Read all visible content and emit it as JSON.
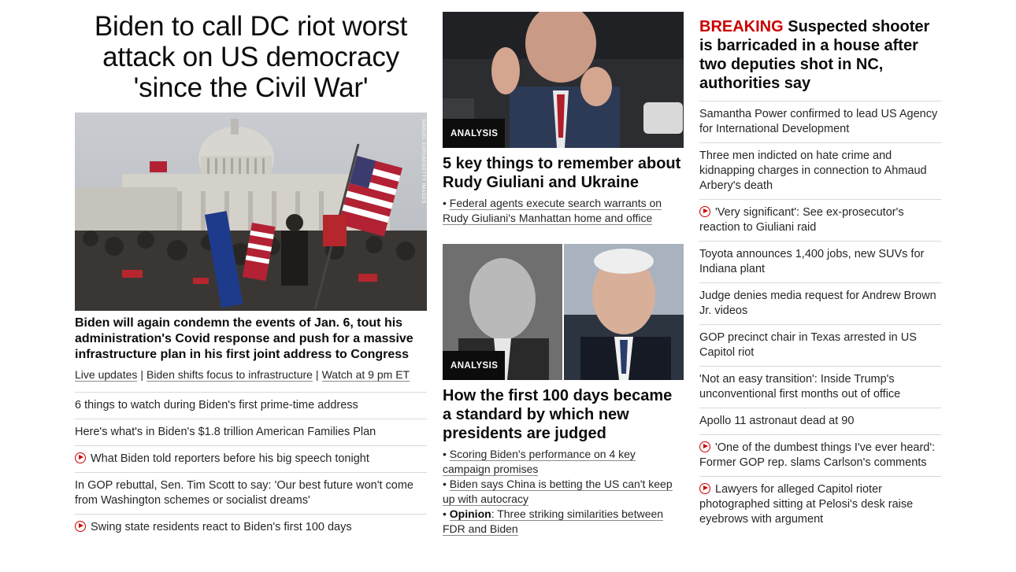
{
  "hero": {
    "headline": "Biden to call DC riot worst attack on US democracy 'since the Civil War'",
    "photo_credit": "SAMUEL CORUM/GETTY IMAGES",
    "subhead": "Biden will again condemn the events of Jan. 6, tout his administration's Covid response and push for a massive infrastructure plan in his first joint address to Congress",
    "links": [
      "Live updates",
      "Biden shifts focus to infrastructure",
      "Watch at 9 pm ET"
    ],
    "separator": "|"
  },
  "left_list": [
    {
      "text": "6 things to watch during Biden's first prime-time address",
      "video": false
    },
    {
      "text": "Here's what's in Biden's $1.8 trillion American Families Plan",
      "video": false
    },
    {
      "text": "What Biden told reporters before his big speech tonight",
      "video": true
    },
    {
      "text": "In GOP rebuttal, Sen. Tim Scott to say: 'Our best future won't come from Washington schemes or socialist dreams'",
      "video": false
    },
    {
      "text": "Swing state residents react to Biden's first 100 days",
      "video": true
    }
  ],
  "card1": {
    "label": "ANALYSIS",
    "title": "5 key things to remember about Rudy Giuliani and Ukraine",
    "links": [
      {
        "bullet": "•",
        "text": "Federal agents execute search warrants on Rudy Giuliani's Manhattan home and office"
      }
    ]
  },
  "card2": {
    "label": "ANALYSIS",
    "title": "How the first 100 days became a standard by which new presidents are judged",
    "links": [
      {
        "bullet": "•",
        "prefix": "",
        "text": "Scoring Biden's performance on 4 key campaign promises"
      },
      {
        "bullet": "•",
        "prefix": "",
        "text": "Biden says China is betting the US can't keep up with autocracy"
      },
      {
        "bullet": "•",
        "prefix": "Opinion",
        "text": ": Three striking similarities between FDR and Biden"
      }
    ]
  },
  "breaking": {
    "tag": "BREAKING",
    "text": " Suspected shooter is barricaded in a house after two deputies shot in NC, authorities say"
  },
  "right_list": [
    {
      "text": "Samantha Power confirmed to lead US Agency for International Development",
      "video": false
    },
    {
      "text": "Three men indicted on hate crime and kidnapping charges in connection to Ahmaud Arbery's death",
      "video": false
    },
    {
      "text": "'Very significant': See ex-prosecutor's reaction to Giuliani raid",
      "video": true
    },
    {
      "text": "Toyota announces 1,400 jobs, new SUVs for Indiana plant",
      "video": false
    },
    {
      "text": "Judge denies media request for Andrew Brown Jr. videos",
      "video": false
    },
    {
      "text": "GOP precinct chair in Texas arrested in US Capitol riot",
      "video": false
    },
    {
      "text": "'Not an easy transition': Inside Trump's unconventional first months out of office",
      "video": false
    },
    {
      "text": "Apollo 11 astronaut dead at 90",
      "video": false
    },
    {
      "text": "'One of the dumbest things I've ever heard': Former GOP rep. slams Carlson's comments",
      "video": true
    },
    {
      "text": "Lawyers for alleged Capitol rioter photographed sitting at Pelosi's desk raise eyebrows with argument",
      "video": true
    }
  ],
  "colors": {
    "breaking_red": "#cc0000",
    "text": "#0c0c0c",
    "divider": "#d9d9d9",
    "label_bg": "#0c0c0c"
  },
  "icons": {
    "video": "play-circle-icon"
  }
}
